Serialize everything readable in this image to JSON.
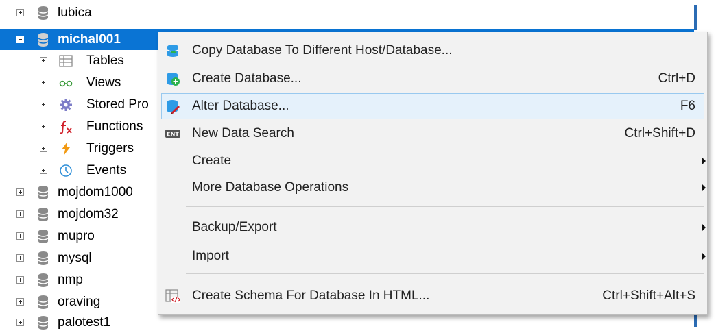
{
  "tree": {
    "databases_top": [
      {
        "label": "lubica"
      },
      {
        "label": "michal001"
      }
    ],
    "children": [
      {
        "label": "Tables",
        "icon": "table-icon"
      },
      {
        "label": "Views",
        "icon": "glasses-icon"
      },
      {
        "label": "Stored Pro",
        "icon": "gear-icon"
      },
      {
        "label": "Functions",
        "icon": "function-icon"
      },
      {
        "label": "Triggers",
        "icon": "lightning-icon"
      },
      {
        "label": "Events",
        "icon": "clock-icon"
      }
    ],
    "databases_bottom": [
      {
        "label": "mojdom1000"
      },
      {
        "label": "mojdom32"
      },
      {
        "label": "mupro"
      },
      {
        "label": "mysql"
      },
      {
        "label": "nmp"
      },
      {
        "label": "oraving"
      },
      {
        "label": "palotest1"
      }
    ]
  },
  "menu": {
    "items": [
      {
        "label": "Copy Database To Different Host/Database...",
        "shortcut": "",
        "icon": "copy-database-icon"
      },
      {
        "label": "Create Database...",
        "shortcut": "Ctrl+D",
        "icon": "create-database-icon"
      },
      {
        "label": "Alter Database...",
        "shortcut": "F6",
        "icon": "alter-database-icon"
      },
      {
        "label": "New Data Search",
        "shortcut": "Ctrl+Shift+D",
        "icon": "data-search-icon",
        "icon_text": "ENT"
      },
      {
        "label": "Create",
        "shortcut": "",
        "icon": ""
      },
      {
        "label": "More Database Operations",
        "shortcut": "",
        "icon": ""
      },
      {
        "label": "Backup/Export",
        "shortcut": "",
        "icon": ""
      },
      {
        "label": "Import",
        "shortcut": "",
        "icon": ""
      },
      {
        "label": "Create Schema For Database In HTML...",
        "shortcut": "Ctrl+Shift+Alt+S",
        "icon": "schema-html-icon"
      }
    ]
  },
  "colors": {
    "selection": "#0a74d4",
    "hover": "#e5f1fb",
    "menu_bg": "#f2f2f2"
  }
}
